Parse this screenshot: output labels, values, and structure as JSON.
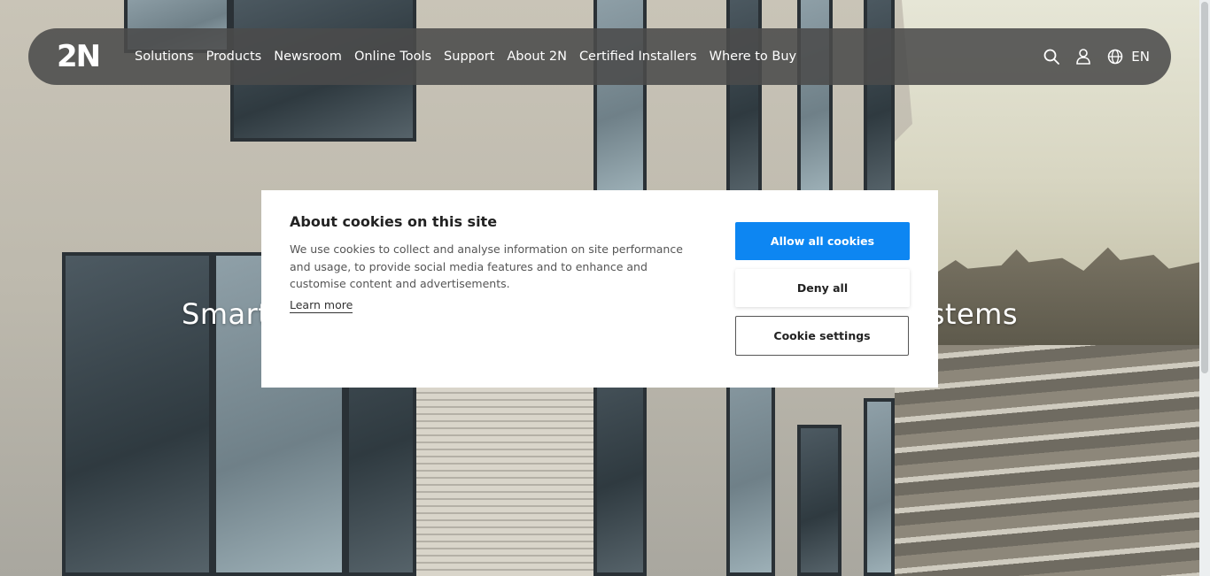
{
  "brand": {
    "logo_text": "2N"
  },
  "nav": {
    "links": [
      "Solutions",
      "Products",
      "Newsroom",
      "Online Tools",
      "Support",
      "About 2N",
      "Certified Installers",
      "Where to Buy"
    ],
    "language": "EN",
    "icons": [
      "search-icon",
      "user-icon",
      "globe-icon"
    ]
  },
  "hero": {
    "title_left": "Smart",
    "title_right": "stems"
  },
  "cookie_banner": {
    "title": "About cookies on this site",
    "body": "We use cookies to collect and analyse information on site performance and usage, to provide social media features and to enhance and customise content and advertisements.",
    "learn_more": "Learn more",
    "allow_all": "Allow all cookies",
    "deny_all": "Deny all",
    "settings": "Cookie settings"
  },
  "colors": {
    "navbar_bg": "#4b4b4b",
    "accent_blue": "#0d86f2",
    "modal_bg": "#ffffff"
  }
}
